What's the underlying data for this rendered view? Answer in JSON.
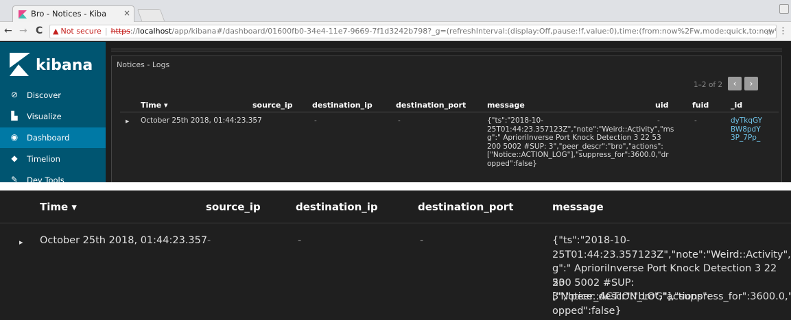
{
  "browser": {
    "tab_title": "Bro - Notices - Kiba",
    "tab_close": "×",
    "security_label": "Not secure",
    "url_scheme": "https",
    "url_host": "localhost",
    "url_rest": "/app/kibana#/dashboard/01600fb0-34e4-11e7-9669-7f1d3242b798?_g=(refreshInterval:(display:Off,pause:!f,value:0),time:(from:now%2Fw,mode:quick,to:now%..."
  },
  "app": {
    "name": "kibana",
    "nav": [
      {
        "label": "Discover",
        "icon": "compass-icon"
      },
      {
        "label": "Visualize",
        "icon": "bar-chart-icon"
      },
      {
        "label": "Dashboard",
        "icon": "dashboard-icon",
        "active": true
      },
      {
        "label": "Timelion",
        "icon": "timelion-icon"
      },
      {
        "label": "Dev Tools",
        "icon": "wrench-icon"
      }
    ]
  },
  "panel": {
    "title": "Notices - Logs",
    "pagination": "1–2 of 2"
  },
  "table": {
    "columns": {
      "time": "Time",
      "source_ip": "source_ip",
      "destination_ip": "destination_ip",
      "destination_port": "destination_port",
      "message": "message",
      "uid": "uid",
      "fuid": "fuid",
      "id": "_id"
    },
    "row": {
      "time": "October 25th 2018, 01:44:23.357",
      "source_ip": "-",
      "destination_ip": "-",
      "destination_port": "-",
      "uid": "-",
      "fuid": "-",
      "id_lines": [
        "dyTkqGY",
        "BW8pdY",
        "3P_7Pp_"
      ],
      "message_lines_small": [
        "{\"ts\":\"2018-10-",
        "25T01:44:23.357123Z\",\"note\":\"Weird::Activity\",\"ms",
        "g\":\" AprioriInverse Port Knock Detection 3 22 53",
        "200 5002  #SUP: 3\",\"peer_descr\":\"bro\",\"actions\":",
        "[\"Notice::ACTION_LOG\"],\"suppress_for\":3600.0,\"dr",
        "opped\":false}"
      ],
      "message_lines_large": [
        "{\"ts\":\"2018-10-",
        "25T01:44:23.357123Z\",\"note\":\"Weird::Activity\",\"ms",
        "g\":\" AprioriInverse Port Knock Detection 3 22 53",
        "200 5002  #SUP: 3\",\"peer_descr\":\"bro\",\"actions\":",
        "[\"Notice::ACTION_LOG\"],\"suppress_for\":3600.0,\"dr",
        "opped\":false}"
      ]
    }
  }
}
